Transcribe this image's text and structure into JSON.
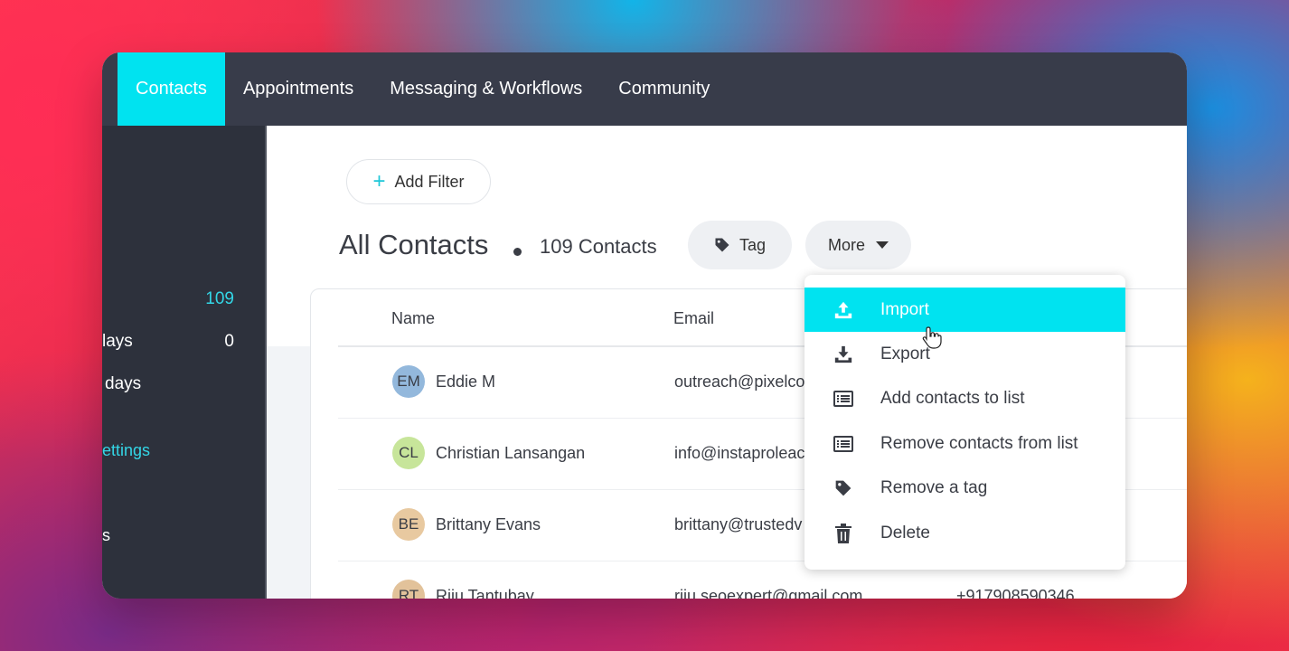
{
  "nav": {
    "tabs": [
      {
        "label": "Contacts",
        "active": true
      },
      {
        "label": "Appointments",
        "active": false
      },
      {
        "label": "Messaging & Workflows",
        "active": false
      },
      {
        "label": "Community",
        "active": false
      }
    ]
  },
  "sidebar": {
    "rows": [
      {
        "label": "",
        "count": "109",
        "color": "#33d6e6"
      },
      {
        "label": "lays",
        "count": "0",
        "color": "#ffffff"
      },
      {
        "label": "days",
        "count": "",
        "color": "#ffffff"
      },
      {
        "label": "ettings",
        "count": "",
        "color": "#33d6e6"
      },
      {
        "label": "s",
        "count": "",
        "color": "#ffffff"
      }
    ]
  },
  "toolbar": {
    "add_filter_label": "Add Filter",
    "title": "All Contacts",
    "count_label": "109 Contacts",
    "tag_label": "Tag",
    "more_label": "More"
  },
  "table": {
    "headers": {
      "name": "Name",
      "email": "Email"
    },
    "rows": [
      {
        "initials": "EM",
        "name": "Eddie M",
        "email": "outreach@pixelco",
        "phone": "",
        "avatar_color": "#93b8dc"
      },
      {
        "initials": "CL",
        "name": "Christian Lansangan",
        "email": "info@instaproleac",
        "phone": "",
        "avatar_color": "#c7e59a"
      },
      {
        "initials": "BE",
        "name": "Brittany Evans",
        "email": "brittany@trustedv",
        "phone": "",
        "avatar_color": "#e8c9a0"
      },
      {
        "initials": "RT",
        "name": "Riju Tantubay",
        "email": "riju.seoexpert@gmail.com",
        "phone": "+917908590346",
        "avatar_color": "#e2c29a"
      }
    ]
  },
  "more_menu": {
    "items": [
      {
        "label": "Import",
        "icon": "upload-icon",
        "active": true
      },
      {
        "label": "Export",
        "icon": "download-icon",
        "active": false
      },
      {
        "label": "Add contacts to list",
        "icon": "list-icon",
        "active": false
      },
      {
        "label": "Remove contacts from list",
        "icon": "list-icon",
        "active": false
      },
      {
        "label": "Remove a tag",
        "icon": "tag-icon",
        "active": false
      },
      {
        "label": "Delete",
        "icon": "trash-icon",
        "active": false
      }
    ]
  },
  "colors": {
    "accent": "#00e3f0",
    "nav_bg": "#383c4a",
    "sidebar_bg": "#2d313c"
  }
}
